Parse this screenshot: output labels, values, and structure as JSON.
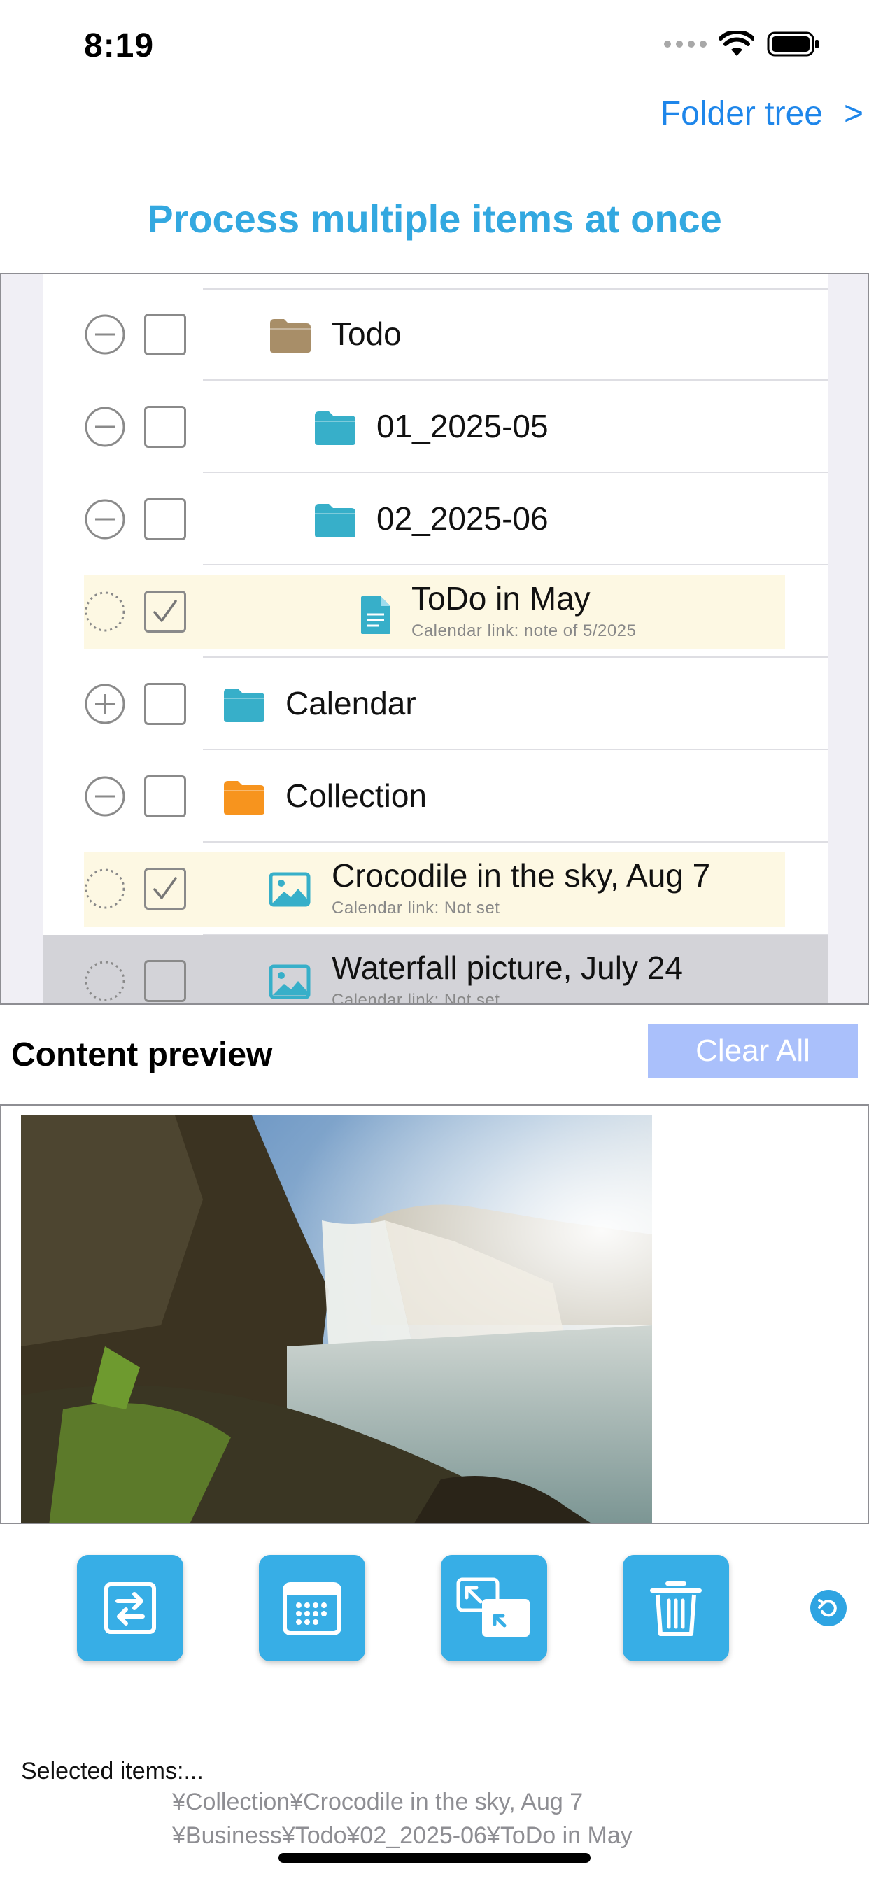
{
  "status_bar": {
    "time": "8:19"
  },
  "nav": {
    "folder_tree_label": "Folder tree",
    "chevron": ">"
  },
  "title": "Process multiple items at once",
  "tree": {
    "rows": [
      {
        "label": "Todo",
        "sub": "",
        "expander": "minus",
        "checked": false,
        "icon": "folder-icon",
        "icon_color": "#a88e68"
      },
      {
        "label": "01_2025-05",
        "sub": "",
        "expander": "minus",
        "checked": false,
        "icon": "folder-icon",
        "icon_color": "#37afc9"
      },
      {
        "label": "02_2025-06",
        "sub": "",
        "expander": "minus",
        "checked": false,
        "icon": "folder-icon",
        "icon_color": "#37afc9"
      },
      {
        "label": "ToDo in May",
        "sub": "Calendar link: note of 5/2025",
        "expander": "dotted",
        "checked": true,
        "icon": "document-icon",
        "icon_color": "#37afc9"
      },
      {
        "label": "Calendar",
        "sub": "",
        "expander": "plus",
        "checked": false,
        "icon": "folder-icon",
        "icon_color": "#37afc9"
      },
      {
        "label": "Collection",
        "sub": "",
        "expander": "minus",
        "checked": false,
        "icon": "folder-icon",
        "icon_color": "#f7941e"
      },
      {
        "label": "Crocodile in the sky, Aug 7",
        "sub": "Calendar link: Not set",
        "expander": "dotted",
        "checked": true,
        "icon": "image-icon",
        "icon_color": "#37afc9"
      },
      {
        "label": "Waterfall picture, July 24",
        "sub": "Calendar link: Not set",
        "expander": "dotted",
        "checked": false,
        "icon": "image-icon",
        "icon_color": "#37afc9"
      }
    ]
  },
  "preview": {
    "header": "Content preview",
    "clear_all_label": "Clear All"
  },
  "toolbar": {
    "icons": [
      "move-icon",
      "calendar-icon",
      "resize-icon",
      "trash-icon",
      "undo-icon"
    ],
    "accent": "#37aee6"
  },
  "selected": {
    "label": "Selected items:...",
    "paths": [
      "¥Collection¥Crocodile in the sky, Aug 7",
      "¥Business¥Todo¥02_2025-06¥ToDo in May"
    ]
  },
  "colors": {
    "accent_blue": "#1e86ea",
    "title_blue": "#33a8e0",
    "selected_row": "#fdf8e3",
    "clear_all_bg": "#aac0fb"
  }
}
